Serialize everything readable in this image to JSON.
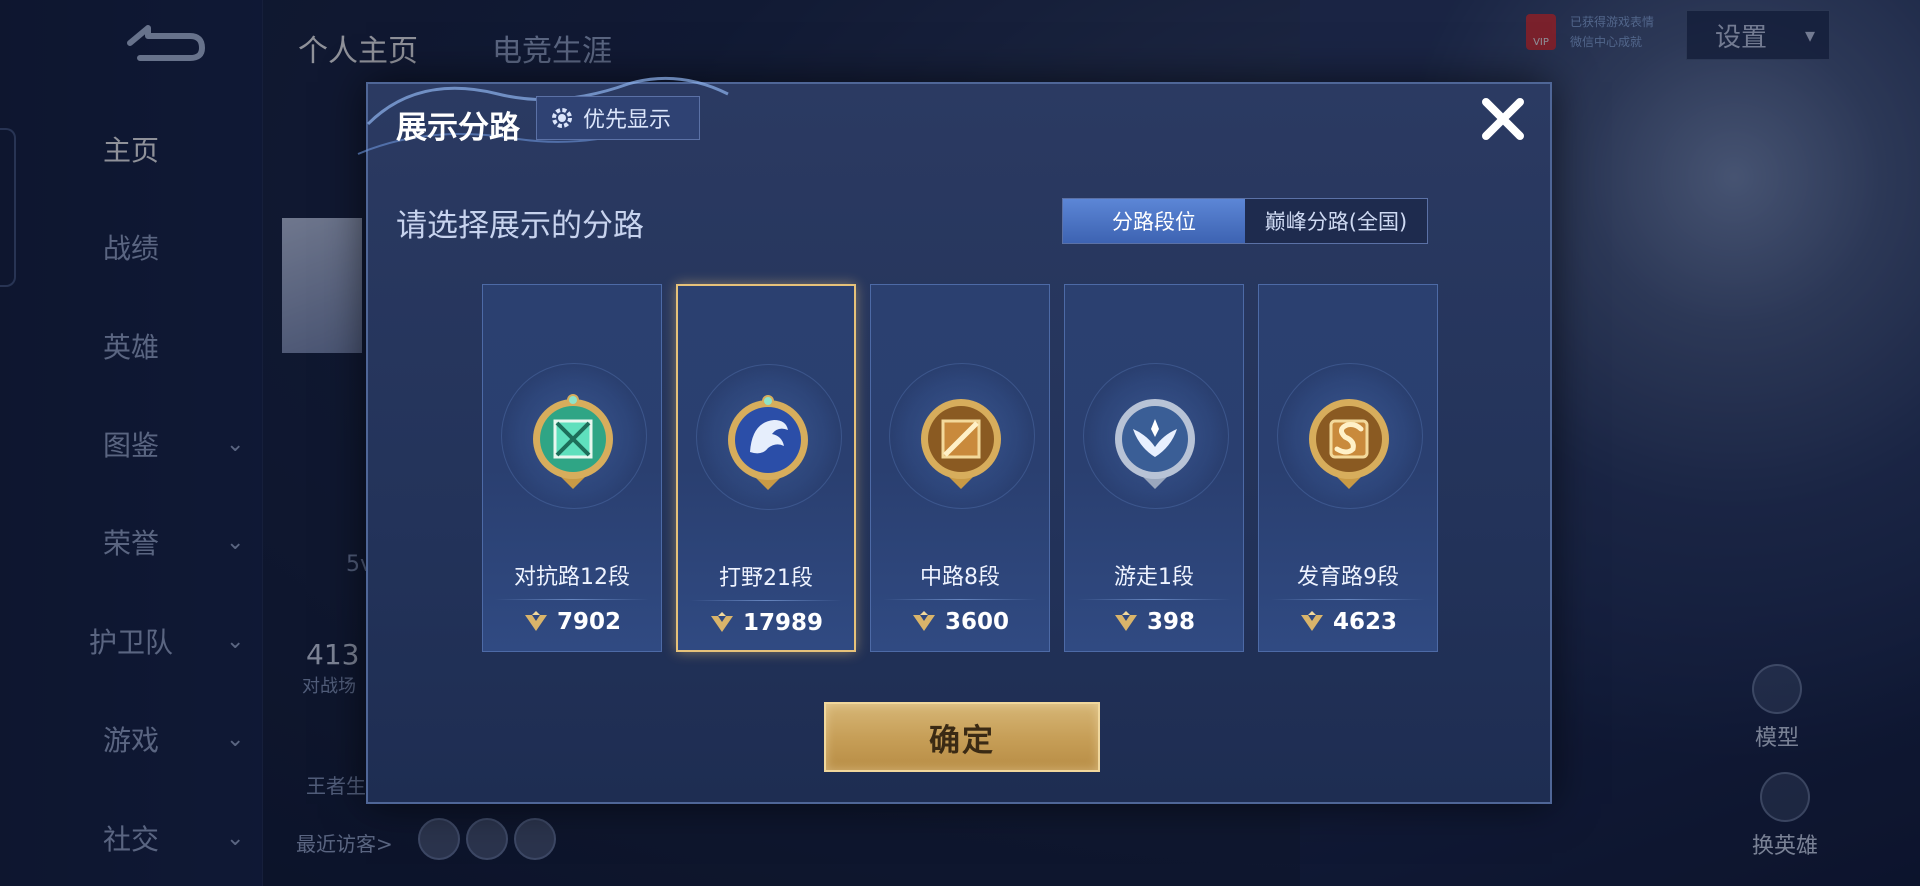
{
  "background": {
    "top_tabs": [
      "个人主页",
      "电竞生涯"
    ],
    "settings_label": "设置",
    "vip_label": "VIP",
    "vip_text": [
      "已获得游戏表情",
      "微信中心成就"
    ],
    "sidebar_items": [
      {
        "label": "主页",
        "active": true,
        "has_chevron": false
      },
      {
        "label": "战绩",
        "active": false,
        "has_chevron": false
      },
      {
        "label": "英雄",
        "active": false,
        "has_chevron": false
      },
      {
        "label": "图鉴",
        "active": false,
        "has_chevron": true
      },
      {
        "label": "荣誉",
        "active": false,
        "has_chevron": true
      },
      {
        "label": "护卫队",
        "active": false,
        "has_chevron": true
      },
      {
        "label": "游戏",
        "active": false,
        "has_chevron": true
      },
      {
        "label": "社交",
        "active": false,
        "has_chevron": true
      }
    ],
    "fragments": {
      "a": "5v",
      "b": "413",
      "c": "对战场",
      "d": "王者生"
    },
    "recent_visitors_label": "最近访客>",
    "right_buttons": {
      "model": "模型",
      "change_hero": "换英雄"
    }
  },
  "modal": {
    "title": "展示分路",
    "priority_button": "优先显示",
    "subtitle": "请选择展示的分路",
    "segment_tabs": [
      {
        "label": "分路段位",
        "active": true
      },
      {
        "label": "巅峰分路(全国)",
        "active": false
      }
    ],
    "lanes": [
      {
        "name": "对抗路12段",
        "points": "7902",
        "selected": false,
        "badge": "green"
      },
      {
        "name": "打野21段",
        "points": "17989",
        "selected": true,
        "badge": "blue-dragon"
      },
      {
        "name": "中路8段",
        "points": "3600",
        "selected": false,
        "badge": "gold-slash"
      },
      {
        "name": "游走1段",
        "points": "398",
        "selected": false,
        "badge": "silver-wing"
      },
      {
        "name": "发育路9段",
        "points": "4623",
        "selected": false,
        "badge": "gold-s"
      }
    ],
    "confirm_label": "确定"
  }
}
